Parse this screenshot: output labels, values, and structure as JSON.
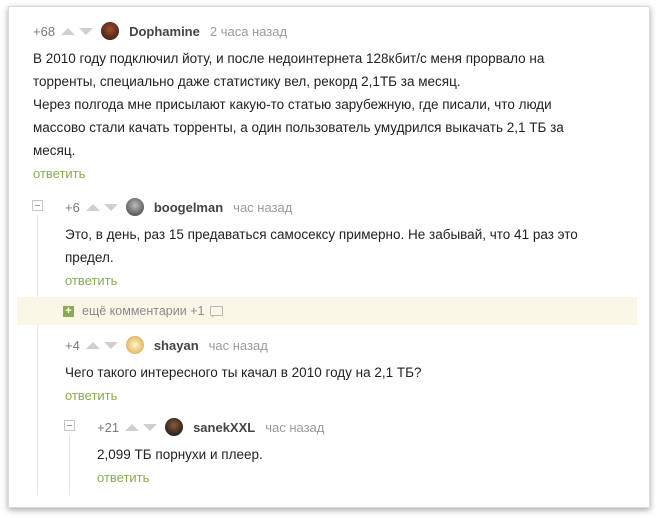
{
  "reply_label": "ответить",
  "comments": [
    {
      "rating": "+68",
      "username": "Dophamine",
      "time": "2 часа назад",
      "avatar_color": "#5a2a1a",
      "lines": [
        "В 2010 году подключил йоту, и после недоинтернета 128кбит/с меня прорвало на",
        "торренты, специально даже статистику вел, рекорд 2,1ТБ за месяц.",
        "Через полгода мне присылают какую-то статью зарубежную, где писали, что люди",
        "массово стали качать торренты, а один пользователь умудрился выкачать 2,1 ТБ за",
        "месяц."
      ]
    },
    {
      "rating": "+6",
      "username": "boogelman",
      "time": "час назад",
      "avatar_color": "#6b6b6b",
      "lines": [
        "Это, в день, раз 15 предаваться самосексу примерно. Не забывай, что 41 раз это",
        "предел."
      ]
    },
    {
      "rating": "+4",
      "username": "shayan",
      "time": "час назад",
      "avatar_color": "#e8c77a",
      "lines": [
        "Чего такого интересного ты качал в 2010 году на 2,1 ТБ?"
      ]
    },
    {
      "rating": "+21",
      "username": "sanekXXL",
      "time": "час назад",
      "avatar_color": "#3a2a22",
      "lines": [
        "2,099 ТБ порнухи и плеер."
      ]
    }
  ],
  "more_comments": {
    "label": "ещё комментарии +1",
    "plus": "+"
  }
}
